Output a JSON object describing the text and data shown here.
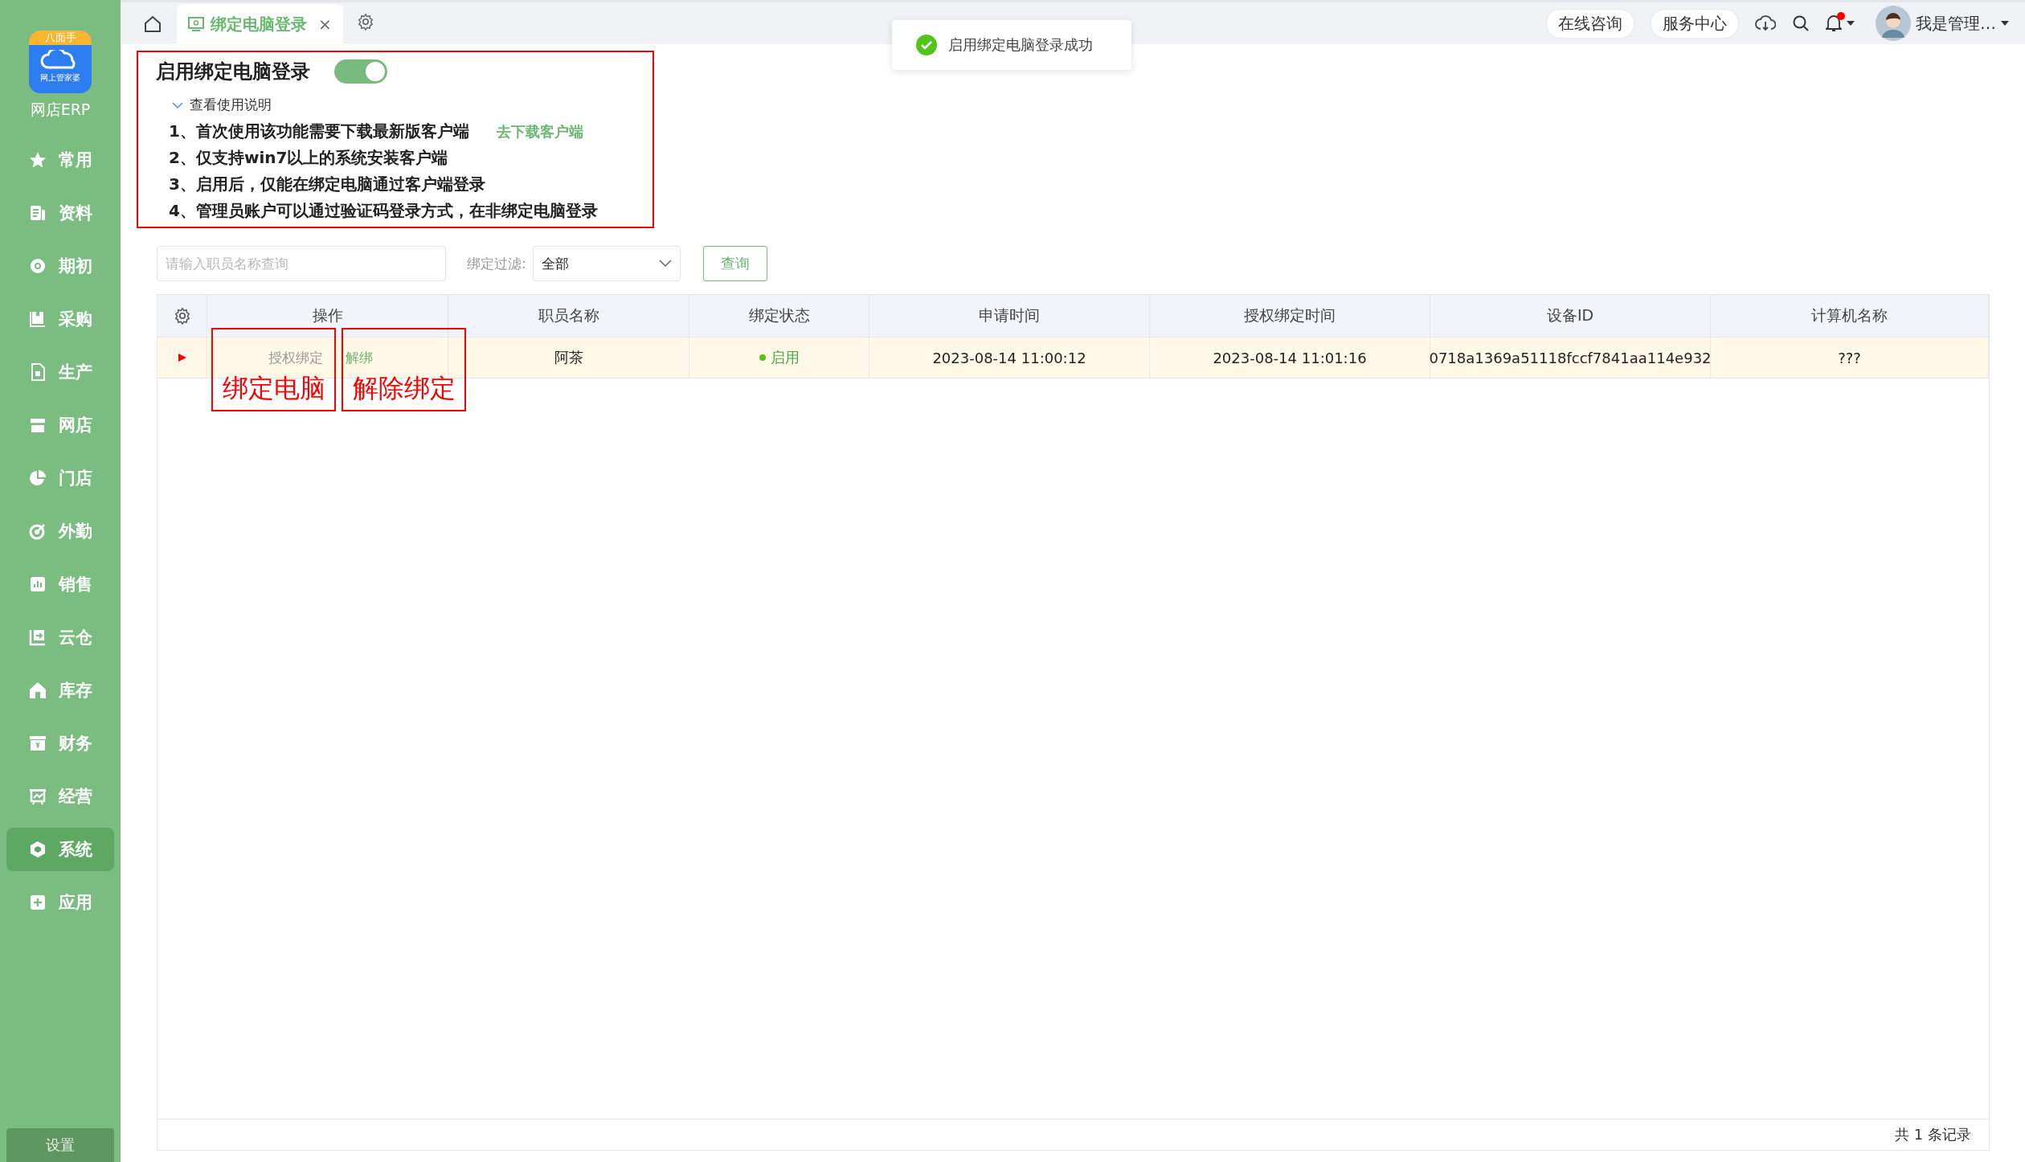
{
  "sidebar": {
    "logo": {
      "banner": "八面手",
      "caption": "网上管家婆"
    },
    "app_name": "网店ERP",
    "items": [
      {
        "label": "常用",
        "selected": false
      },
      {
        "label": "资料",
        "selected": false
      },
      {
        "label": "期初",
        "selected": false
      },
      {
        "label": "采购",
        "selected": false
      },
      {
        "label": "生产",
        "selected": false
      },
      {
        "label": "网店",
        "selected": false
      },
      {
        "label": "门店",
        "selected": false
      },
      {
        "label": "外勤",
        "selected": false
      },
      {
        "label": "销售",
        "selected": false
      },
      {
        "label": "云仓",
        "selected": false
      },
      {
        "label": "库存",
        "selected": false
      },
      {
        "label": "财务",
        "selected": false
      },
      {
        "label": "经营",
        "selected": false
      },
      {
        "label": "系统",
        "selected": true
      },
      {
        "label": "应用",
        "selected": false
      }
    ],
    "settings": "设置"
  },
  "tabs": [
    {
      "label": "绑定电脑登录",
      "selected": true,
      "close": "×"
    }
  ],
  "header": {
    "buttons": [
      "在线咨询",
      "服务中心"
    ],
    "notification_dot": true,
    "user": "我是管理…"
  },
  "toast": {
    "message": "启用绑定电脑登录成功"
  },
  "settings_panel": {
    "title": "启用绑定电脑登录",
    "enabled": true,
    "help_toggle": "查看使用说明",
    "expanded": true,
    "steps": [
      {
        "text": "1、首次使用该功能需要下载最新版客户端",
        "link": "去下载客户端"
      },
      {
        "text": "2、仅支持win7以上的系统安装客户端"
      },
      {
        "text": "3、启用后，仅能在绑定电脑通过客户端登录"
      },
      {
        "text": "4、管理员账户可以通过验证码登录方式，在非绑定电脑登录"
      }
    ]
  },
  "filter": {
    "search_placeholder": "请输入职员名称查询",
    "label": "绑定过滤:",
    "select_value": "全部",
    "query_button": "查询"
  },
  "table": {
    "columns": [
      "操作",
      "职员名称",
      "绑定状态",
      "申请时间",
      "授权绑定时间",
      "设备ID",
      "计算机名称"
    ],
    "rows": [
      {
        "selected": true,
        "actions": [
          {
            "label": "授权绑定",
            "disabled": true
          },
          {
            "label": "解绑",
            "disabled": false
          }
        ],
        "employee": "阿茶",
        "status": "启用",
        "color": "#52c41a",
        "applied": "2023-08-14 11:00:12",
        "authorized": "2023-08-14 11:01:16",
        "device_id": "0718a1369a51118fccf7841aa114e932",
        "computer": "???"
      }
    ],
    "footer": "共 1 条记录"
  },
  "annotations": [
    {
      "text": "绑定电脑"
    },
    {
      "text": "解除绑定"
    }
  ]
}
